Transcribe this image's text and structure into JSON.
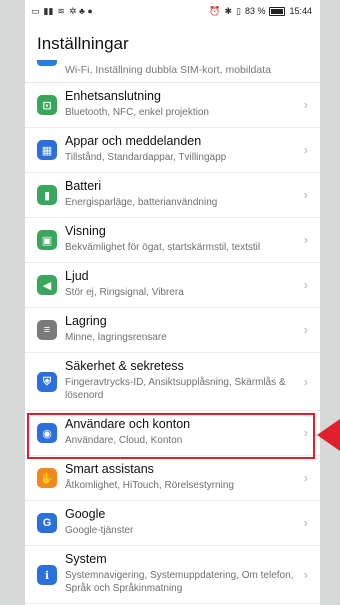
{
  "status_bar": {
    "left_icons": [
      "sim-icon",
      "signal-icon",
      "wifi-icon",
      "notification-icons"
    ],
    "right_text": "✆ ✱ 83 % ",
    "time": "15:44",
    "battery_percent": 83
  },
  "page_title": "Inställningar",
  "partial_item": {
    "subtitle": "Wi-Fi, Inställning dubbla SIM-kort, mobildata"
  },
  "items": [
    {
      "title": "Enhetsanslutning",
      "subtitle": "Bluetooth, NFC, enkel projektion",
      "icon": "device-connection-icon",
      "color": "#3aa55d",
      "glyph": "⊡"
    },
    {
      "title": "Appar och meddelanden",
      "subtitle": "Tillstånd, Standardappar, Tvillingapp",
      "icon": "apps-icon",
      "color": "#2a6fdb",
      "glyph": "▦"
    },
    {
      "title": "Batteri",
      "subtitle": "Energisparläge, batterianvändning",
      "icon": "battery-icon",
      "color": "#3aa55d",
      "glyph": "▮"
    },
    {
      "title": "Visning",
      "subtitle": "Bekvämlighet för ögat, startskärmstil, textstil",
      "icon": "display-icon",
      "color": "#3aa55d",
      "glyph": "▣"
    },
    {
      "title": "Ljud",
      "subtitle": "Stör ej, Ringsignal, Vibrera",
      "icon": "sound-icon",
      "color": "#3aa55d",
      "glyph": "◀"
    },
    {
      "title": "Lagring",
      "subtitle": "Minne, lagringsrensare",
      "icon": "storage-icon",
      "color": "#7a7a7a",
      "glyph": "≡"
    },
    {
      "title": "Säkerhet & sekretess",
      "subtitle": "Fingeravtrycks-ID, Ansiktsupplåsning, Skärmlås & lösenord",
      "icon": "security-icon",
      "color": "#2a6fdb",
      "glyph": "⛨",
      "tall": true
    },
    {
      "title": "Användare och konton",
      "subtitle": "Användare, Cloud, Konton",
      "icon": "users-icon",
      "color": "#2a6fdb",
      "glyph": "◉"
    },
    {
      "title": "Smart assistans",
      "subtitle": "Åtkomlighet, HiTouch, Rörelsestyrning",
      "icon": "smart-assist-icon",
      "color": "#f08a1c",
      "glyph": "✋"
    },
    {
      "title": "Google",
      "subtitle": "Google-tjänster",
      "icon": "google-icon",
      "color": "#2a6fdb",
      "glyph": "G"
    },
    {
      "title": "System",
      "subtitle": "Systemnavigering, Systemuppdatering, Om telefon, Språk och Språkinmatning",
      "icon": "system-icon",
      "color": "#2a6fdb",
      "glyph": "ℹ",
      "tall": true
    }
  ],
  "highlight_color": "#e0202c"
}
